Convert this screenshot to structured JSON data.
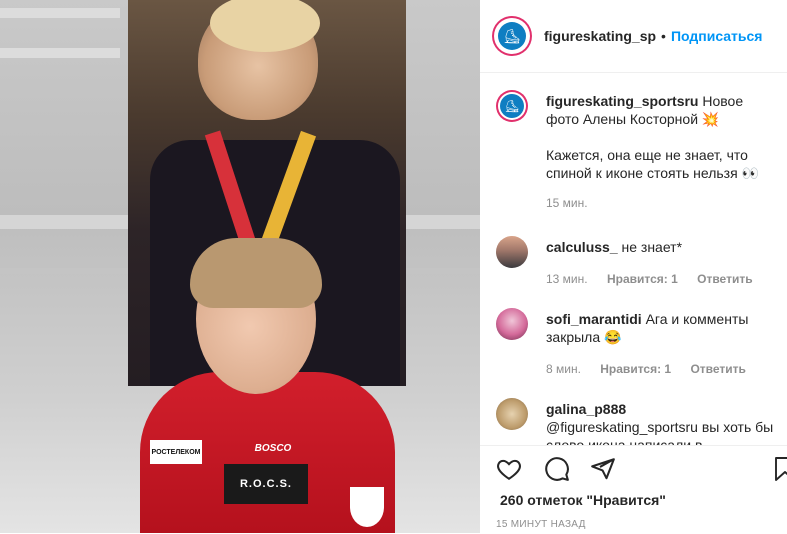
{
  "post": {
    "username": "figureskating_sp",
    "follow_label": "Подписаться",
    "dot": "•"
  },
  "comments": [
    {
      "username": "figureskating_sportsru",
      "text": "Новое фото Алены Косторной 💥",
      "text2": "Кажется, она еще не знает, что спиной к иконе стоять нельзя 👀",
      "time": "15 мин."
    },
    {
      "username": "calculuss_",
      "text": "не знает*",
      "time": "13 мин.",
      "likes": "Нравится: 1",
      "reply": "Ответить"
    },
    {
      "username": "sofi_marantidi",
      "text": "Ага и комменты закрыла 😂",
      "time": "8 мин.",
      "likes": "Нравится: 1",
      "reply": "Ответить"
    },
    {
      "username": "galina_p888",
      "text": "@figureskating_sportsru вы хоть бы слово икона написали в"
    }
  ],
  "photo": {
    "patch_left": "РОСТЕЛЕКОМ",
    "patch_brand": "BOSCO",
    "patch_center": "R.O.C.S."
  },
  "footer": {
    "likes_text": "260 отметок \"Нравится\"",
    "time_text": "15 МИНУТ НАЗАД"
  },
  "icons": {
    "like": "heart-icon",
    "comment": "comment-icon",
    "share": "share-icon",
    "save": "bookmark-icon"
  },
  "colors": {
    "follow": "#0095f6",
    "avatar_ring": "#e1306c",
    "jacket": "#c81927"
  }
}
